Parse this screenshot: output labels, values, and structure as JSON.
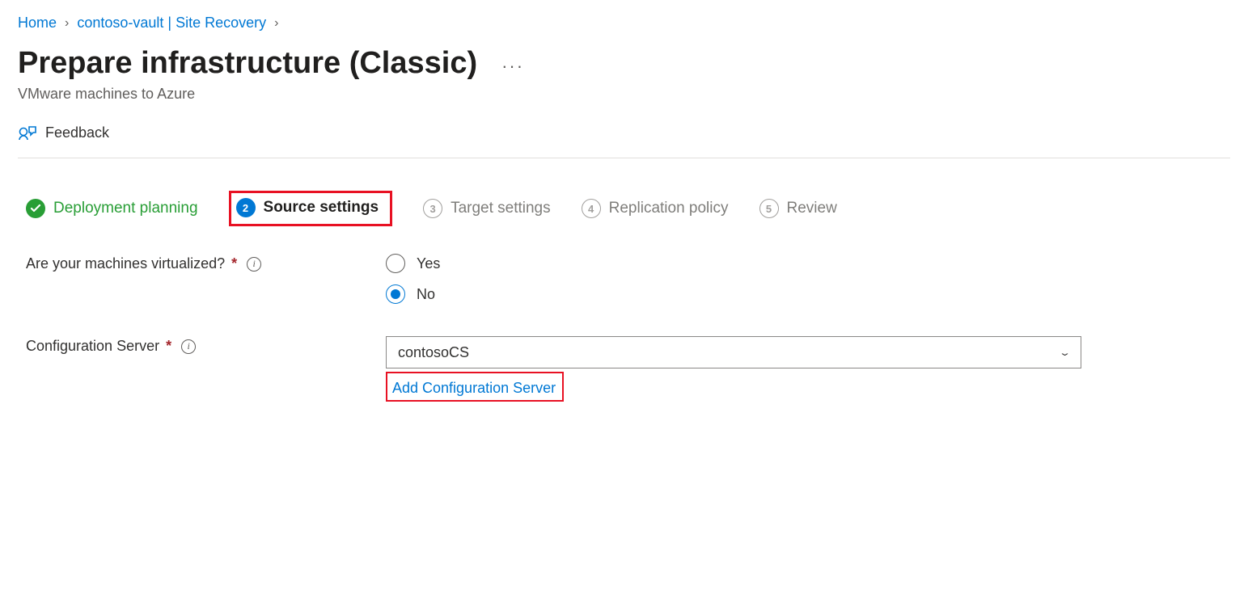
{
  "breadcrumb": {
    "home": "Home",
    "vault": "contoso-vault | Site Recovery"
  },
  "header": {
    "title": "Prepare infrastructure (Classic)",
    "subtitle": "VMware machines to Azure",
    "feedback": "Feedback"
  },
  "steps": {
    "s1": "Deployment planning",
    "s2_num": "2",
    "s2": "Source settings",
    "s3_num": "3",
    "s3": "Target settings",
    "s4_num": "4",
    "s4": "Replication policy",
    "s5_num": "5",
    "s5": "Review"
  },
  "form": {
    "virtualized_label": "Are your machines virtualized?",
    "yes": "Yes",
    "no": "No",
    "config_server_label": "Configuration Server",
    "config_server_value": "contosoCS",
    "add_config_server": "Add Configuration Server"
  }
}
